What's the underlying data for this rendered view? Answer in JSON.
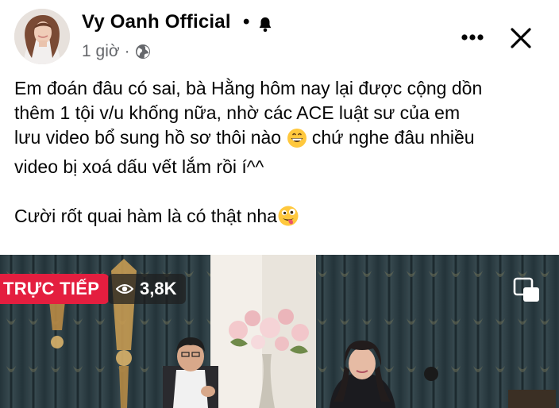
{
  "post": {
    "author": "Vy Oanh Official",
    "separator": "•",
    "time": "1 giờ",
    "time_separator": "·",
    "icons": {
      "avatar": "profile-photo",
      "follow": "bell-icon",
      "audience": "globe-icon",
      "more": "more-horizontal-icon",
      "close": "close-icon"
    },
    "text": {
      "line1": "Em đoán đâu có sai, bà Hằng hôm nay lại được cộng dồn",
      "line2": "thêm 1 tội v/u khống nữa, nhờ các ACE luật sư của em",
      "line3_a": "lưu video bổ sung hồ sơ thôi nào",
      "line3_b": "chứ nghe đâu nhiều",
      "line4": "video bị xoá dấu vết lắm rồi í^^",
      "line5": "Cười rốt quai hàm là có thật nha"
    }
  },
  "video": {
    "live_label": "TRỰC TIẾP",
    "viewer_count": "3,8K",
    "icons": {
      "viewers": "eye-icon",
      "pip": "picture-in-picture-icon"
    },
    "colors": {
      "live_badge": "#e41e3f",
      "curtain": "#2e3c41"
    }
  },
  "colors": {
    "text": "#050505",
    "secondary_text": "#65676b"
  }
}
